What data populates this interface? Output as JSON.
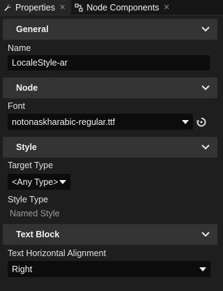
{
  "tabs": [
    {
      "label": "Properties",
      "icon": "wrench-icon",
      "active": true
    },
    {
      "label": "Node Components",
      "icon": "components-icon",
      "active": false
    }
  ],
  "sections": {
    "general": {
      "title": "General"
    },
    "node": {
      "title": "Node"
    },
    "style": {
      "title": "Style"
    },
    "text_block": {
      "title": "Text Block"
    }
  },
  "fields": {
    "name": {
      "label": "Name",
      "value": "LocaleStyle-ar"
    },
    "font": {
      "label": "Font",
      "value": "notonaskharabic-regular.ttf"
    },
    "target_type": {
      "label": "Target Type",
      "value": "<Any Type>"
    },
    "style_type": {
      "label": "Style Type",
      "value": "Named Style"
    },
    "text_horizontal_alignment": {
      "label": "Text Horizontal Alignment",
      "value": "Right"
    }
  },
  "tab_close_glyph": "✕"
}
